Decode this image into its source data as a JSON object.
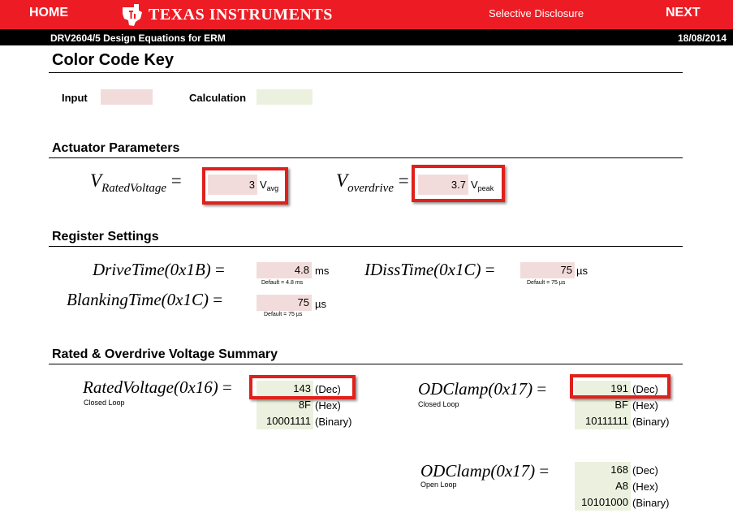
{
  "header": {
    "home": "HOME",
    "brand": "TEXAS INSTRUMENTS",
    "subtitle": "Selective Disclosure",
    "next": "NEXT",
    "doc_title": "DRV2604/5 Design Equations for ERM",
    "date": "18/08/2014",
    "bar_color": "#ed1c24"
  },
  "color_key": {
    "title": "Color Code Key",
    "input_label": "Input",
    "calc_label": "Calculation",
    "input_color": "#f2dcdb",
    "calc_color": "#ebf1de"
  },
  "actuator": {
    "title": "Actuator Parameters",
    "rated": {
      "symbol": "V",
      "sub": "RatedVoltage",
      "eq": "=",
      "value": "3",
      "unit": "V",
      "unit_sub": "avg"
    },
    "overdrive": {
      "symbol": "V",
      "sub": "overdrive",
      "eq": "=",
      "value": "3.7",
      "unit": "V",
      "unit_sub": "peak"
    }
  },
  "register": {
    "title": "Register Settings",
    "drive_time": {
      "label": "DriveTime(0x1B)",
      "eq": "=",
      "value": "4.8",
      "unit": "ms",
      "default": "Default = 4.8 ms"
    },
    "idiss_time": {
      "label": "IDissTime(0x1C)",
      "eq": "=",
      "value": "75",
      "unit": "µs",
      "default": "Default = 75 µs"
    },
    "blanking_time": {
      "label": "BlankingTime(0x1C)",
      "eq": "=",
      "value": "75",
      "unit": "µs",
      "default": "Default = 75 µs"
    }
  },
  "summary": {
    "title": "Rated & Overdrive Voltage Summary",
    "rated_voltage": {
      "label": "RatedVoltage(0x16)",
      "eq": "=",
      "mode": "Closed Loop",
      "dec": "143",
      "hex": "8F",
      "bin": "10001111",
      "dec_label": "(Dec)",
      "hex_label": "(Hex)",
      "bin_label": "(Binary)"
    },
    "od_clamp_closed": {
      "label": "ODClamp(0x17)",
      "eq": "=",
      "mode": "Closed Loop",
      "dec": "191",
      "hex": "BF",
      "bin": "10111111",
      "dec_label": "(Dec)",
      "hex_label": "(Hex)",
      "bin_label": "(Binary)"
    },
    "od_clamp_open": {
      "label": "ODClamp(0x17)",
      "eq": "=",
      "mode": "Open Loop",
      "dec": "168",
      "hex": "A8",
      "bin": "10101000",
      "dec_label": "(Dec)",
      "hex_label": "(Hex)",
      "bin_label": "(Binary)"
    }
  }
}
